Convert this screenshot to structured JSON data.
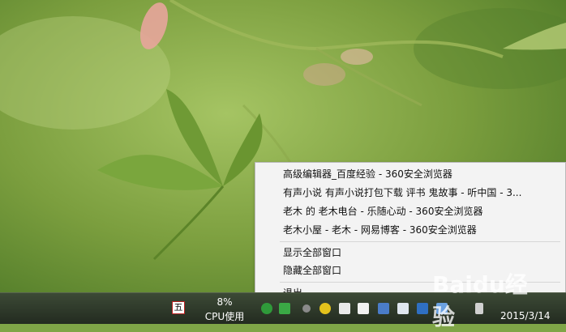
{
  "context_menu": {
    "windows": [
      "高级编辑器_百度经验 - 360安全浏览器",
      "有声小说 有声小说打包下载 评书 鬼故事 - 听中国 - 3...",
      "老木 的 老木电台 - 乐随心动 - 360安全浏览器",
      "老木小屋 - 老木 - 网易博客 - 360安全浏览器"
    ],
    "show_all": "显示全部窗口",
    "hide_all": "隐藏全部窗口",
    "exit": "退出"
  },
  "taskbar": {
    "ime_label": "五",
    "cpu_percent": "8%",
    "cpu_label": "CPU使用",
    "date": "2015/3/14",
    "tray_icons": [
      "360-guard-icon",
      "shield-icon",
      "plus-icon",
      "monitor-icon",
      "card-icon",
      "tray-app-icon",
      "graph-icon",
      "file-icon",
      "network-icon",
      "flag-icon",
      "volume-icon"
    ]
  },
  "watermark": {
    "text": "Baidu经验"
  }
}
